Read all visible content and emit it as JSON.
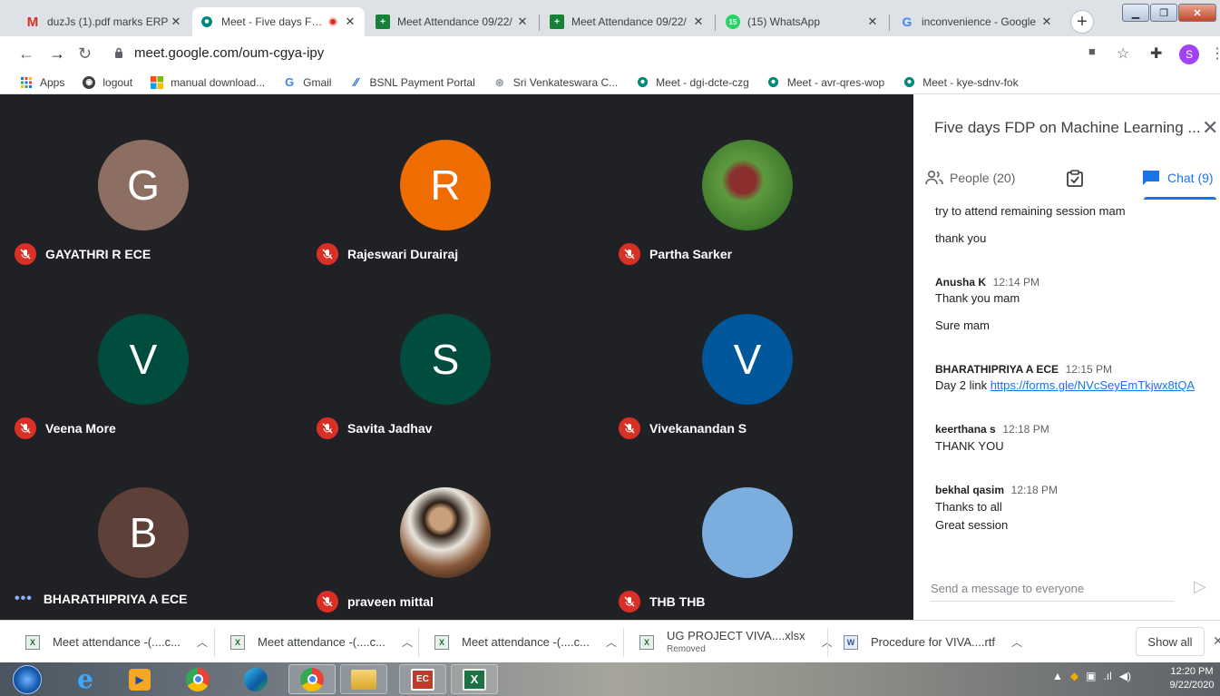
{
  "browser": {
    "tabs": [
      {
        "title": "duzJs (1).pdf marks ERP",
        "icon": "gmail-icon",
        "active": false
      },
      {
        "title": "Meet - Five days FDP",
        "icon": "meet-icon",
        "active": true,
        "recording": true
      },
      {
        "title": "Meet Attendance 09/22/",
        "icon": "sheets-icon",
        "active": false
      },
      {
        "title": "Meet Attendance 09/22/",
        "icon": "sheets-icon",
        "active": false
      },
      {
        "title": "(15) WhatsApp",
        "icon": "whatsapp-icon",
        "active": false
      },
      {
        "title": "inconvenience - Google",
        "icon": "google-icon",
        "active": false
      }
    ],
    "url": "meet.google.com/oum-cgya-ipy",
    "profile_initial": "S",
    "bookmarks": [
      {
        "label": "Apps",
        "icon": "apps-grid-icon"
      },
      {
        "label": "logout",
        "icon": "globe-icon"
      },
      {
        "label": "manual download...",
        "icon": "microsoft-icon"
      },
      {
        "label": "Gmail",
        "icon": "google-icon"
      },
      {
        "label": "BSNL Payment Portal",
        "icon": "bsnl-icon"
      },
      {
        "label": "Sri Venkateswara C...",
        "icon": "college-icon"
      },
      {
        "label": "Meet - dgi-dcte-czg",
        "icon": "meet-icon"
      },
      {
        "label": "Meet - avr-qres-wop",
        "icon": "meet-icon"
      },
      {
        "label": "Meet - kye-sdnv-fok",
        "icon": "meet-icon"
      }
    ]
  },
  "meet": {
    "participants": [
      {
        "name": "GAYATHRI R ECE",
        "initial": "G",
        "color": "#8d6e63",
        "muted": true
      },
      {
        "name": "Rajeswari Durairaj",
        "initial": "R",
        "color": "#ef6c00",
        "muted": true
      },
      {
        "name": "Partha Sarker",
        "initial": "",
        "color": "#4e8b3a",
        "muted": true,
        "photo": true
      },
      {
        "name": "Veena More",
        "initial": "V",
        "color": "#004d40",
        "muted": true
      },
      {
        "name": "Savita Jadhav",
        "initial": "S",
        "color": "#004d40",
        "muted": true
      },
      {
        "name": "Vivekanandan S",
        "initial": "V",
        "color": "#01579b",
        "muted": true
      },
      {
        "name": "BHARATHIPRIYA A ECE",
        "initial": "B",
        "color": "#5d4037",
        "muted": false
      },
      {
        "name": "praveen mittal",
        "initial": "",
        "color": "#7a5a40",
        "muted": true,
        "photo": true
      },
      {
        "name": "THB THB",
        "initial": "",
        "color": "#7baedf",
        "muted": true
      }
    ]
  },
  "panel": {
    "title": "Five days FDP on Machine Learning ...",
    "people_tab": "People (20)",
    "chat_tab": "Chat (9)",
    "messages": [
      {
        "sender": "",
        "time": "",
        "lines": [
          "try to attend remaining session mam"
        ]
      },
      {
        "sender": "",
        "time": "",
        "lines": [
          "thank you"
        ]
      },
      {
        "sender": "Anusha K",
        "time": "12:14 PM",
        "lines": [
          "Thank you mam"
        ]
      },
      {
        "sender": "",
        "time": "",
        "lines": [
          "Sure mam"
        ]
      },
      {
        "sender": "BHARATHIPRIYA A ECE",
        "time": "12:15 PM",
        "lines": [
          "Day 2 link"
        ],
        "link": "https://forms.gle/NVcSeyEmTkjwx8tQA"
      },
      {
        "sender": "keerthana s",
        "time": "12:18 PM",
        "lines": [
          "THANK YOU"
        ]
      },
      {
        "sender": "bekhal qasim",
        "time": "12:18 PM",
        "lines": [
          "Thanks to all",
          "Great session"
        ]
      }
    ],
    "input_placeholder": "Send a message to everyone"
  },
  "downloads": {
    "items": [
      {
        "name": "Meet attendance -(....c...",
        "sub": "",
        "icon": "excel-file-icon"
      },
      {
        "name": "Meet attendance -(....c...",
        "sub": "",
        "icon": "excel-file-icon"
      },
      {
        "name": "Meet attendance -(....c...",
        "sub": "",
        "icon": "excel-file-icon"
      },
      {
        "name": "UG PROJECT VIVA....xlsx",
        "sub": "Removed",
        "icon": "excel-file-icon"
      },
      {
        "name": "Procedure for VIVA....rtf",
        "sub": "",
        "icon": "word-file-icon"
      }
    ],
    "show_all": "Show all"
  },
  "taskbar": {
    "time": "12:20 PM",
    "date": "9/22/2020"
  }
}
